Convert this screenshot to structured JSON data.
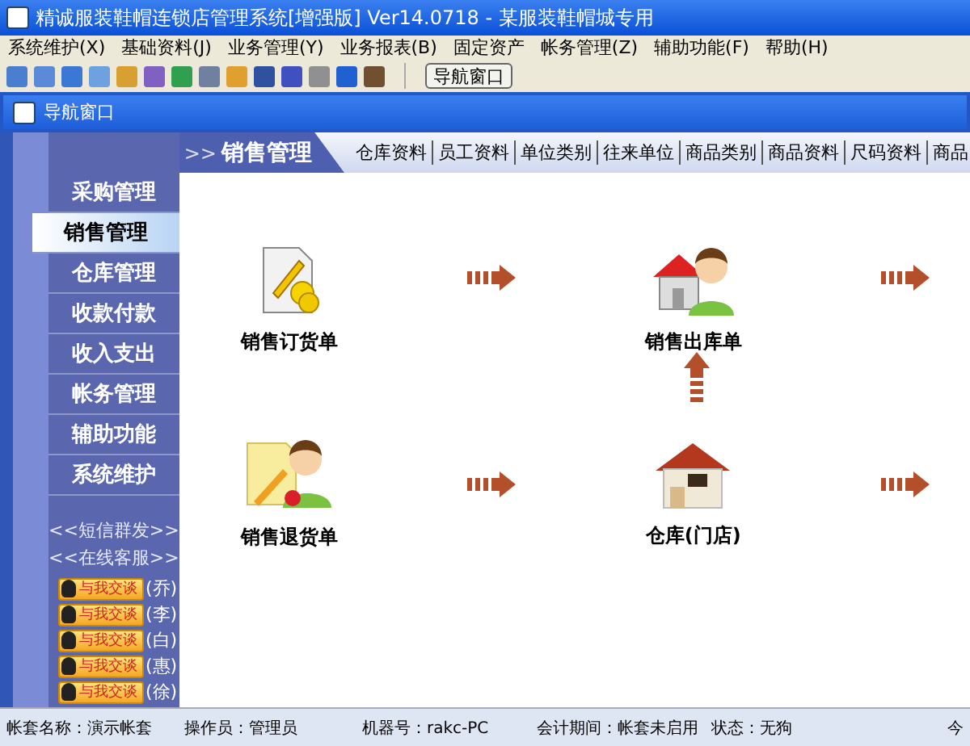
{
  "window": {
    "title": "精诚服装鞋帽连锁店管理系统[增强版] Ver14.0718  -  某服装鞋帽城专用"
  },
  "menu": [
    "系统维护(X)",
    "基础资料(J)",
    "业务管理(Y)",
    "业务报表(B)",
    "固定资产",
    "帐务管理(Z)",
    "辅助功能(F)",
    "帮助(H)"
  ],
  "toolbar": {
    "button": "导航窗口"
  },
  "child_window": {
    "title": "导航窗口"
  },
  "sidebar": {
    "items": [
      {
        "label": "采购管理",
        "selected": false
      },
      {
        "label": "销售管理",
        "selected": true
      },
      {
        "label": "仓库管理",
        "selected": false
      },
      {
        "label": "收款付款",
        "selected": false
      },
      {
        "label": "收入支出",
        "selected": false
      },
      {
        "label": "帐务管理",
        "selected": false
      },
      {
        "label": "辅助功能",
        "selected": false
      },
      {
        "label": "系统维护",
        "selected": false
      }
    ],
    "links": [
      "<<短信群发>>",
      "<<在线客服>>"
    ],
    "chat_buttons": [
      {
        "label": "与我交谈",
        "name": "(乔)"
      },
      {
        "label": "与我交谈",
        "name": "(李)"
      },
      {
        "label": "与我交谈",
        "name": "(白)"
      },
      {
        "label": "与我交谈",
        "name": "(惠)"
      },
      {
        "label": "与我交谈",
        "name": "(徐)"
      }
    ]
  },
  "header": {
    "prefix": ">>",
    "title": "销售管理",
    "links": [
      "仓库资料",
      "员工资料",
      "单位类别",
      "往来单位",
      "商品类别",
      "商品资料",
      "尺码资料",
      "商品"
    ]
  },
  "flow": {
    "nodes": [
      {
        "kind": "order",
        "label": "销售订货单"
      },
      {
        "kind": "outbound",
        "label": "销售出库单"
      },
      {
        "kind": "return",
        "label": "销售退货单"
      },
      {
        "kind": "warehouse",
        "label": "仓库(门店)"
      }
    ]
  },
  "status_bar": [
    "帐套名称：演示帐套",
    "操作员：管理员",
    "机器号：rakc-PC",
    "会计期间：帐套未启用",
    "状态：无狗",
    "今"
  ]
}
